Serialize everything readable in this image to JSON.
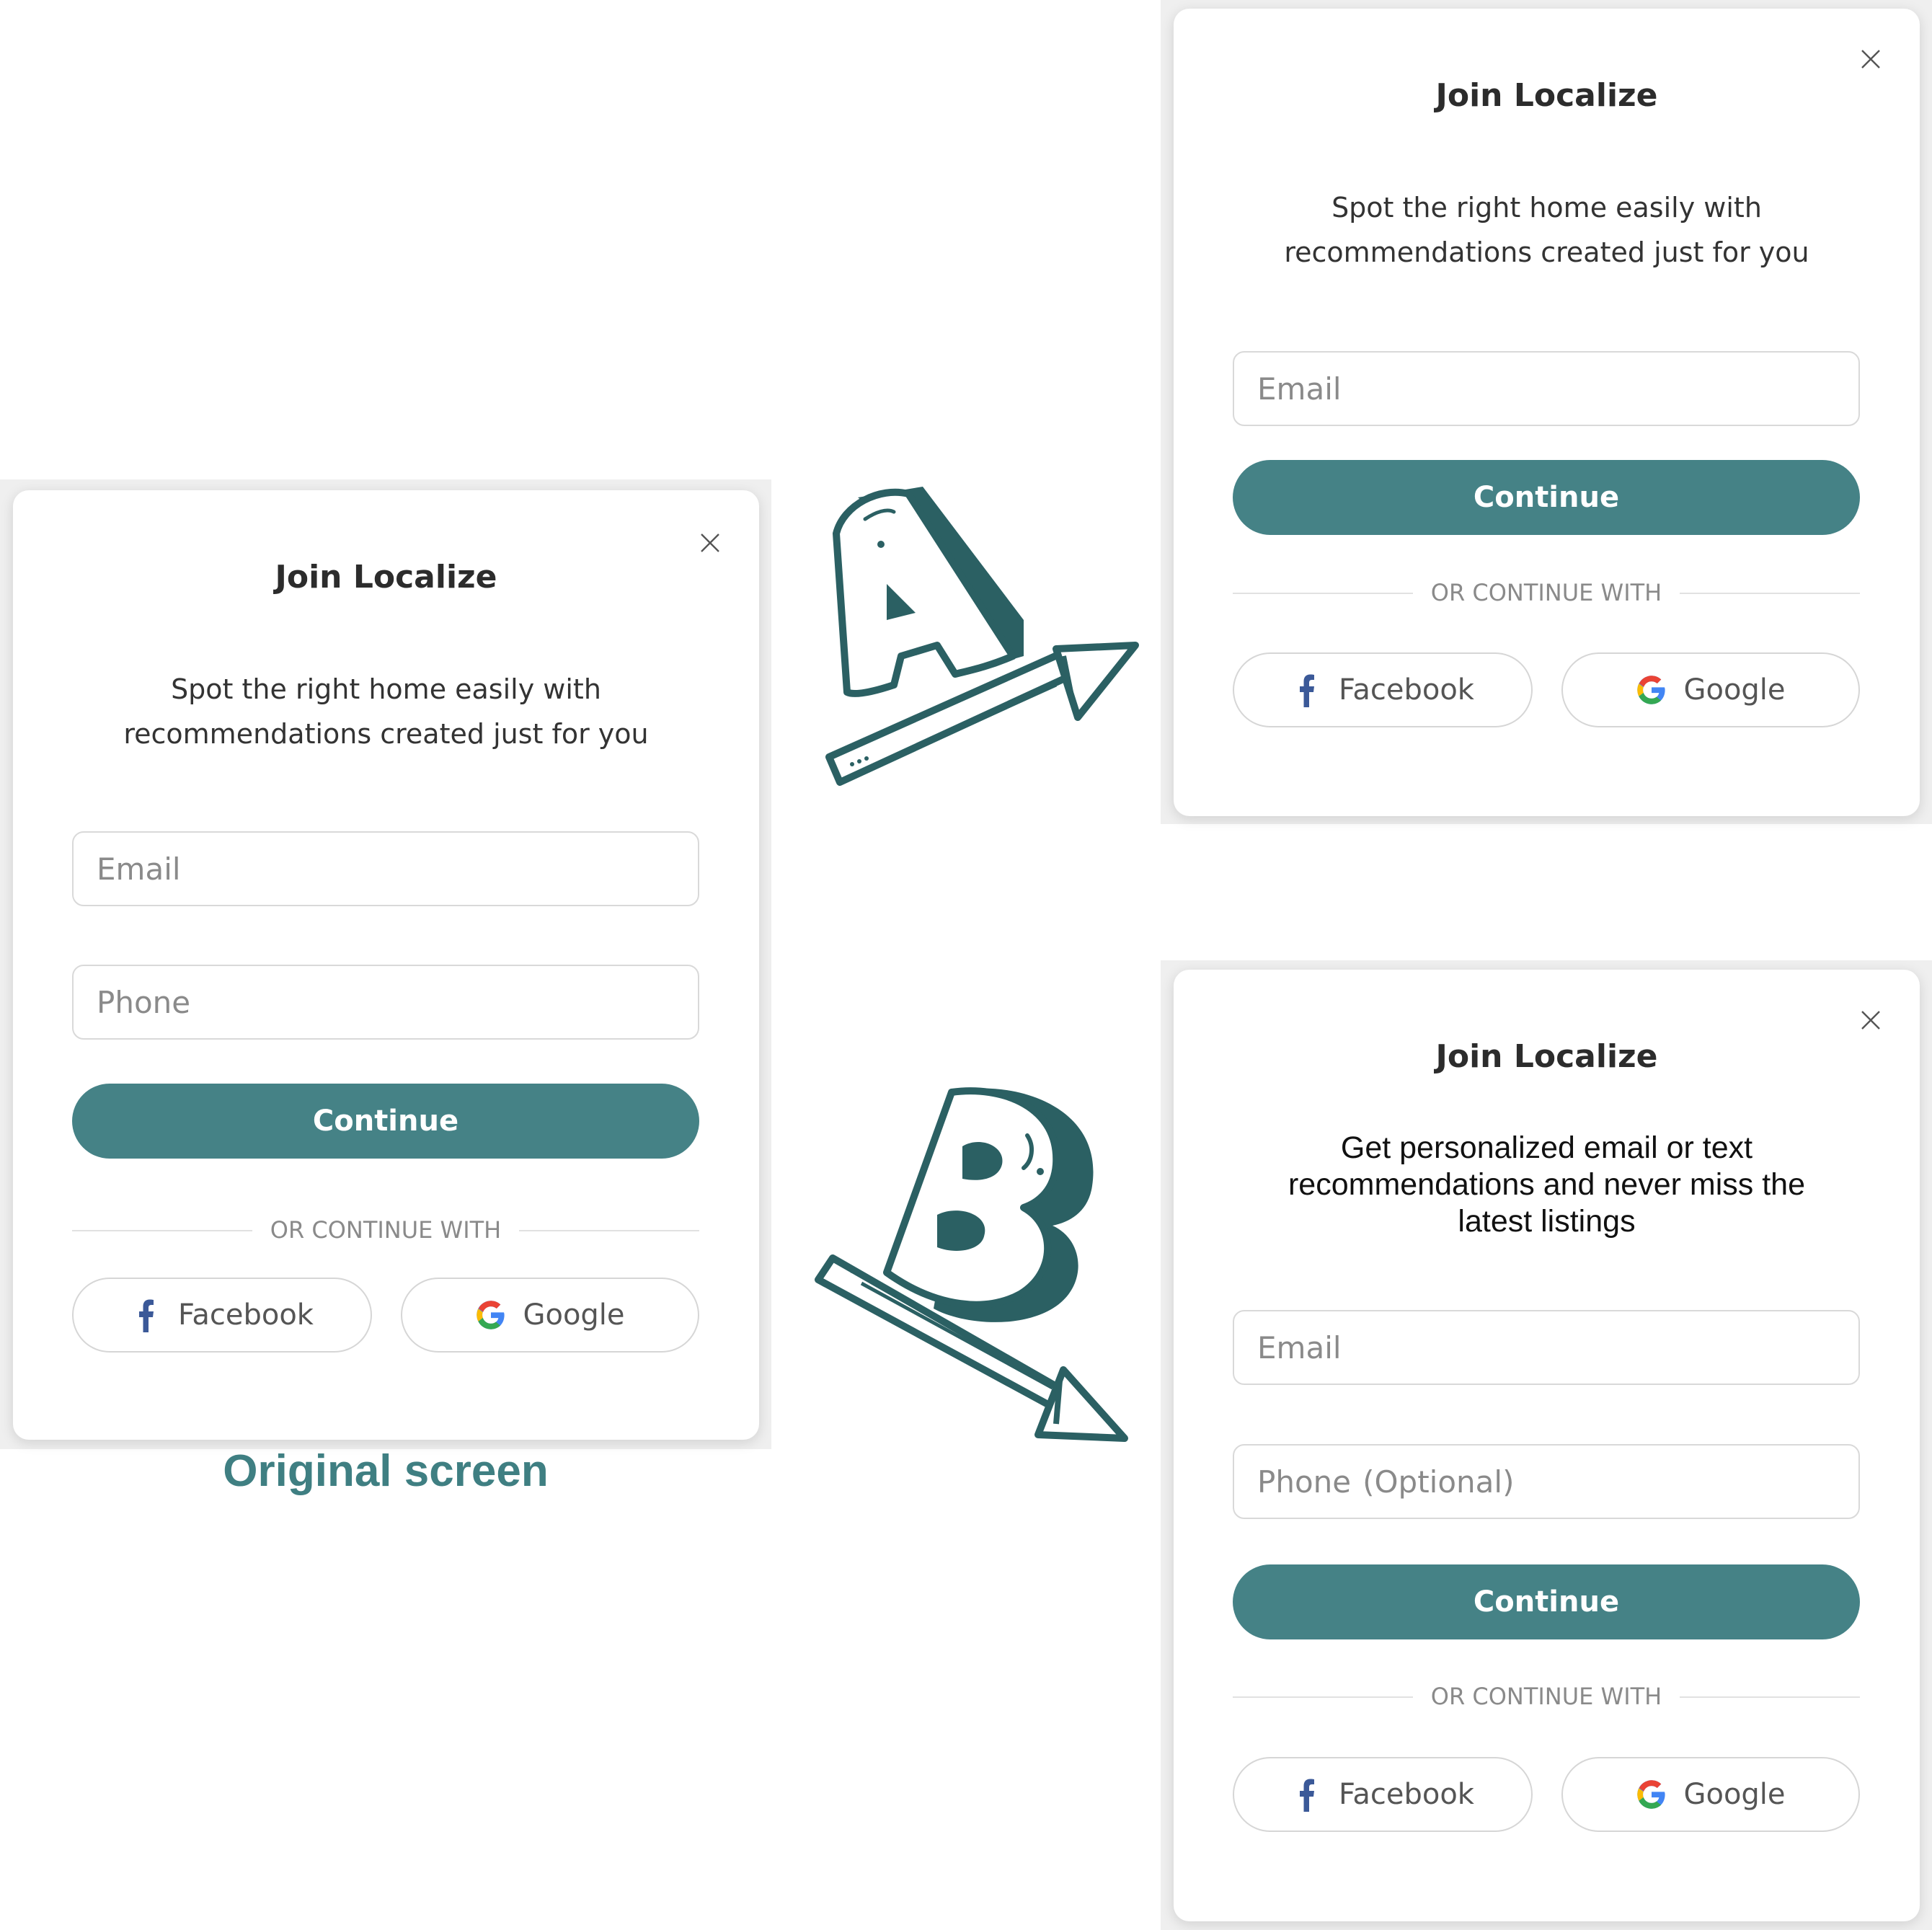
{
  "colors": {
    "accent": "#458286",
    "caption": "#3f7f82",
    "art": "#2b6063"
  },
  "caption": "Original screen",
  "original": {
    "title": "Join Localize",
    "subtitle_line1": "Spot the right home easily with",
    "subtitle_line2": "recommendations created just for you",
    "email_placeholder": "Email",
    "phone_placeholder": "Phone",
    "continue_label": "Continue",
    "divider_text": "OR CONTINUE WITH",
    "facebook_label": "Facebook",
    "google_label": "Google"
  },
  "variant_a": {
    "letter": "A",
    "title": "Join Localize",
    "subtitle_line1": "Spot the right home easily with",
    "subtitle_line2": "recommendations created just for you",
    "email_placeholder": "Email",
    "continue_label": "Continue",
    "divider_text": "OR CONTINUE WITH",
    "facebook_label": "Facebook",
    "google_label": "Google"
  },
  "variant_b": {
    "letter": "B",
    "title": "Join Localize",
    "subtitle_line1": "Get personalized email or text",
    "subtitle_line2": "recommendations and never miss the",
    "subtitle_line3": "latest listings",
    "email_placeholder": "Email",
    "phone_placeholder": "Phone",
    "phone_hint": "(Optional)",
    "continue_label": "Continue",
    "divider_text": "OR CONTINUE WITH",
    "facebook_label": "Facebook",
    "google_label": "Google"
  }
}
